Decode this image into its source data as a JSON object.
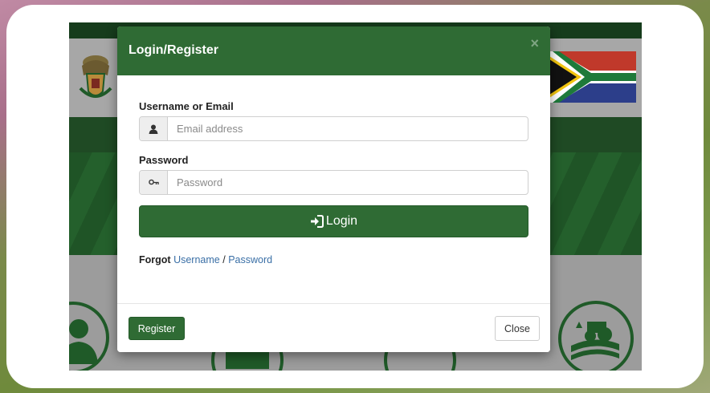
{
  "modal": {
    "title": "Login/Register",
    "close_glyph": "×",
    "username_label": "Username or Email",
    "username_placeholder": "Email address",
    "password_label": "Password",
    "password_placeholder": "Password",
    "login_label": "Login",
    "forgot_prefix": "Forgot",
    "forgot_username": "Username",
    "forgot_separator": "/",
    "forgot_password": "Password",
    "register_label": "Register",
    "close_label": "Close"
  },
  "icons": {
    "username": "user-icon",
    "password": "key-icon",
    "login": "sign-in-icon"
  },
  "colors": {
    "primary_green": "#2f6b34",
    "link_blue": "#3a6fa6"
  }
}
